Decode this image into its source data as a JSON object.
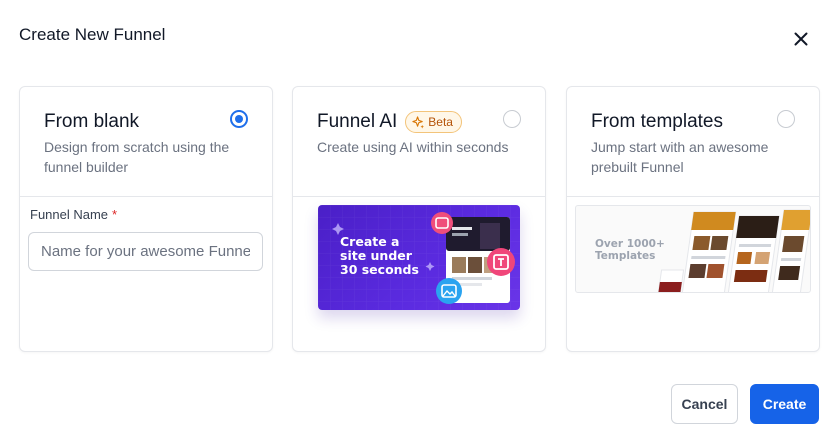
{
  "modal": {
    "title": "Create New Funnel",
    "close_icon": "close-icon"
  },
  "options": [
    {
      "id": "blank",
      "title": "From blank",
      "description": "Design from scratch using the funnel builder",
      "selected": true
    },
    {
      "id": "ai",
      "title": "Funnel AI",
      "badge": "Beta",
      "badge_icon": "sparkle-icon",
      "description": "Create using AI within seconds",
      "preview_text": "Create a site under 30 seconds",
      "selected": false
    },
    {
      "id": "templates",
      "title": "From templates",
      "description": "Jump start with an awesome prebuilt Funnel",
      "preview_text": "Over 1000+ Templates",
      "selected": false
    }
  ],
  "form": {
    "funnel_name_label": "Funnel Name",
    "required_marker": "*",
    "funnel_name_value": "",
    "funnel_name_placeholder": "Name for your awesome Funnel"
  },
  "actions": {
    "cancel_label": "Cancel",
    "create_label": "Create"
  },
  "colors": {
    "primary": "#1663e8",
    "radio_selected": "#1f6feb",
    "beta_border": "#f3c47a",
    "beta_text": "#b45309",
    "ai_preview_bg": "#4a1fc7",
    "required": "#dc2626"
  }
}
